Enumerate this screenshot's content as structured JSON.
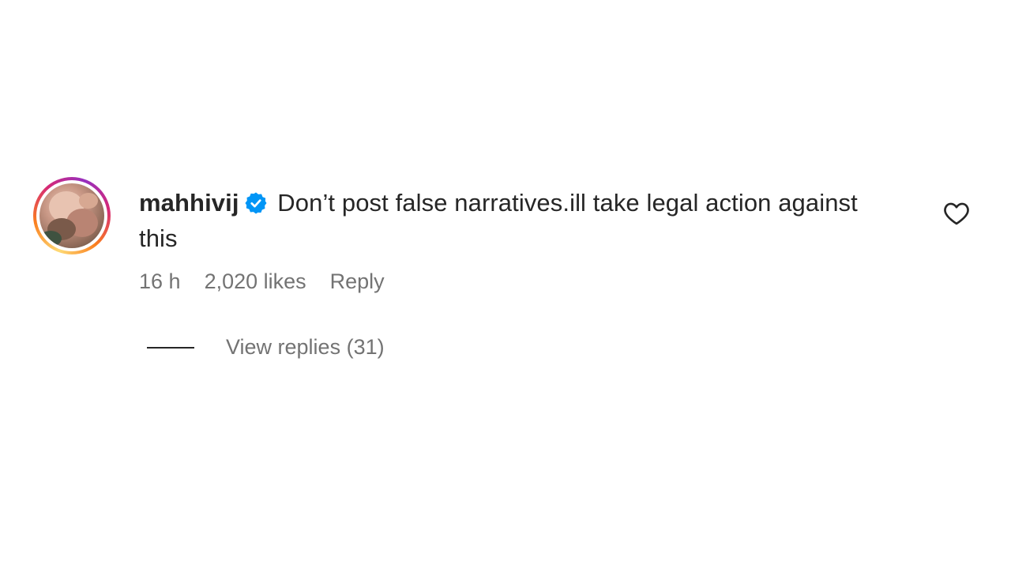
{
  "comment": {
    "username": "mahhivij",
    "verified": true,
    "text": "Don’t post false narratives.ill take legal action against this",
    "time": "16 h",
    "likes": "2,020 likes",
    "reply_label": "Reply",
    "view_replies_label": "View replies (31)"
  },
  "icons": {
    "verified": "verified-badge-icon",
    "like": "heart-outline-icon"
  },
  "colors": {
    "verified_blue": "#0095f6",
    "secondary_text": "#737373",
    "primary_text": "#262626"
  }
}
